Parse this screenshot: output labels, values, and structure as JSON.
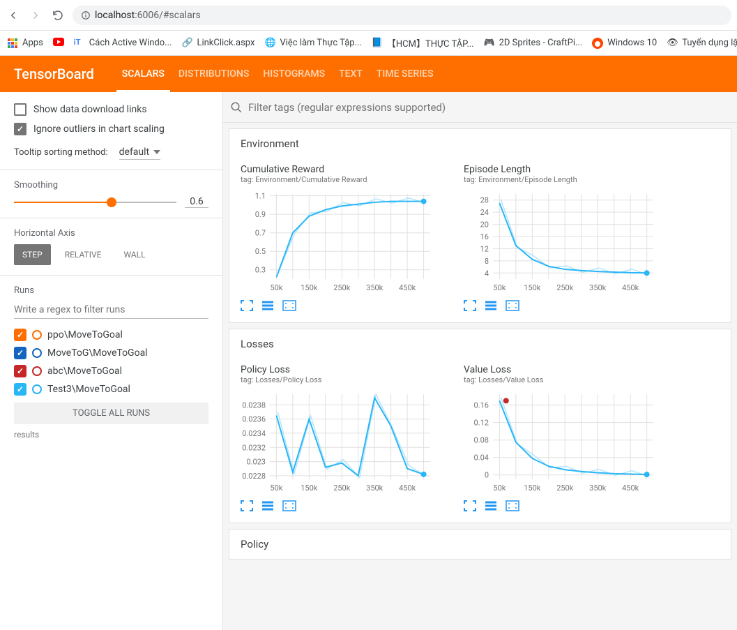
{
  "browser": {
    "url_prefix": "localhost",
    "url_path": ":6006/#scalars",
    "bookmarks": [
      {
        "label": "Apps",
        "icon": "apps"
      },
      {
        "label": "",
        "icon": "youtube"
      },
      {
        "label": "Cách Active Windo...",
        "icon": "it"
      },
      {
        "label": "LinkClick.aspx",
        "icon": "link"
      },
      {
        "label": "Việc làm Thực Tập...",
        "icon": "viec"
      },
      {
        "label": "【HCM】THỰC TẬP...",
        "icon": "hcm"
      },
      {
        "label": "2D Sprites - CraftPi...",
        "icon": "sprites"
      },
      {
        "label": "Windows 10",
        "icon": "reddit"
      },
      {
        "label": "Tuyển dụng lập trìn...",
        "icon": "tuyen"
      }
    ]
  },
  "header": {
    "logo": "TensorBoard",
    "tabs": [
      "SCALARS",
      "DISTRIBUTIONS",
      "HISTOGRAMS",
      "TEXT",
      "TIME SERIES"
    ],
    "active_tab": "SCALARS"
  },
  "sidebar": {
    "show_download": {
      "label": "Show data download links",
      "checked": false
    },
    "ignore_outliers": {
      "label": "Ignore outliers in chart scaling",
      "checked": true
    },
    "tooltip_label": "Tooltip sorting method:",
    "tooltip_value": "default",
    "smoothing_label": "Smoothing",
    "smoothing_value": "0.6",
    "haxis_label": "Horizontal Axis",
    "haxis_options": [
      "STEP",
      "RELATIVE",
      "WALL"
    ],
    "haxis_active": "STEP",
    "runs_label": "Runs",
    "runs_filter_placeholder": "Write a regex to filter runs",
    "runs": [
      {
        "name": "ppo\\MoveToGoal",
        "color": "#ff6f00",
        "checked": true
      },
      {
        "name": "MoveToG\\MoveToGoal",
        "color": "#1565c0",
        "checked": true
      },
      {
        "name": "abc\\MoveToGoal",
        "color": "#c62828",
        "checked": true
      },
      {
        "name": "Test3\\MoveToGoal",
        "color": "#29b6f6",
        "checked": true
      }
    ],
    "toggle_label": "TOGGLE ALL RUNS",
    "results_label": "results"
  },
  "filter_placeholder": "Filter tags (regular expressions supported)",
  "sections": [
    {
      "title": "Environment",
      "charts": [
        "cumulative_reward",
        "episode_length"
      ]
    },
    {
      "title": "Losses",
      "charts": [
        "policy_loss",
        "value_loss"
      ]
    },
    {
      "title": "Policy",
      "charts": []
    }
  ],
  "chart_data": [
    {
      "id": "cumulative_reward",
      "title": "Cumulative Reward",
      "tag": "tag: Environment/Cumulative Reward",
      "type": "line",
      "x": [
        50000,
        100000,
        150000,
        200000,
        250000,
        300000,
        350000,
        400000,
        450000,
        500000
      ],
      "series": [
        {
          "name": "Test3",
          "values": [
            0.22,
            0.7,
            0.88,
            0.95,
            0.99,
            1.01,
            1.03,
            1.04,
            1.04,
            1.04
          ]
        }
      ],
      "xticks": [
        "50k",
        "150k",
        "250k",
        "350k",
        "450k"
      ],
      "yticks": [
        0.3,
        0.5,
        0.7,
        0.9,
        1.1
      ],
      "ylim": [
        0.2,
        1.12
      ],
      "xlim": [
        30000,
        520000
      ]
    },
    {
      "id": "episode_length",
      "title": "Episode Length",
      "tag": "tag: Environment/Episode Length",
      "type": "line",
      "x": [
        50000,
        100000,
        150000,
        200000,
        250000,
        300000,
        350000,
        400000,
        450000,
        500000
      ],
      "series": [
        {
          "name": "Test3",
          "values": [
            27,
            13,
            8.5,
            6.2,
            5.2,
            4.8,
            4.5,
            4.3,
            4.1,
            4.0
          ]
        }
      ],
      "xticks": [
        "50k",
        "150k",
        "250k",
        "350k",
        "450k"
      ],
      "yticks": [
        4,
        8,
        12,
        16,
        20,
        24,
        28
      ],
      "ylim": [
        2,
        30
      ],
      "xlim": [
        30000,
        520000
      ]
    },
    {
      "id": "policy_loss",
      "title": "Policy Loss",
      "tag": "tag: Losses/Policy Loss",
      "type": "line",
      "x": [
        50000,
        100000,
        150000,
        200000,
        250000,
        300000,
        350000,
        400000,
        450000,
        500000
      ],
      "series": [
        {
          "name": "Test3",
          "values": [
            0.02365,
            0.02285,
            0.0236,
            0.02292,
            0.02298,
            0.0228,
            0.0239,
            0.0235,
            0.0229,
            0.02282
          ]
        }
      ],
      "xticks": [
        "50k",
        "150k",
        "250k",
        "350k",
        "450k"
      ],
      "yticks": [
        0.0228,
        0.023,
        0.0232,
        0.0234,
        0.0236,
        0.0238
      ],
      "ylim": [
        0.02275,
        0.02395
      ],
      "xlim": [
        30000,
        520000
      ]
    },
    {
      "id": "value_loss",
      "title": "Value Loss",
      "tag": "tag: Losses/Value Loss",
      "type": "line",
      "x": [
        50000,
        100000,
        150000,
        200000,
        250000,
        300000,
        350000,
        400000,
        450000,
        500000
      ],
      "series": [
        {
          "name": "Test3",
          "values": [
            0.17,
            0.075,
            0.038,
            0.02,
            0.012,
            0.008,
            0.005,
            0.003,
            0.002,
            0.001
          ]
        }
      ],
      "xticks": [
        "50k",
        "150k",
        "250k",
        "350k",
        "450k"
      ],
      "yticks": [
        0,
        0.04,
        0.08,
        0.12,
        0.16
      ],
      "ylim": [
        -0.01,
        0.185
      ],
      "xlim": [
        30000,
        520000
      ],
      "annotation_dot": {
        "x": 70000,
        "y": 0.17,
        "color": "#c62828"
      }
    }
  ]
}
